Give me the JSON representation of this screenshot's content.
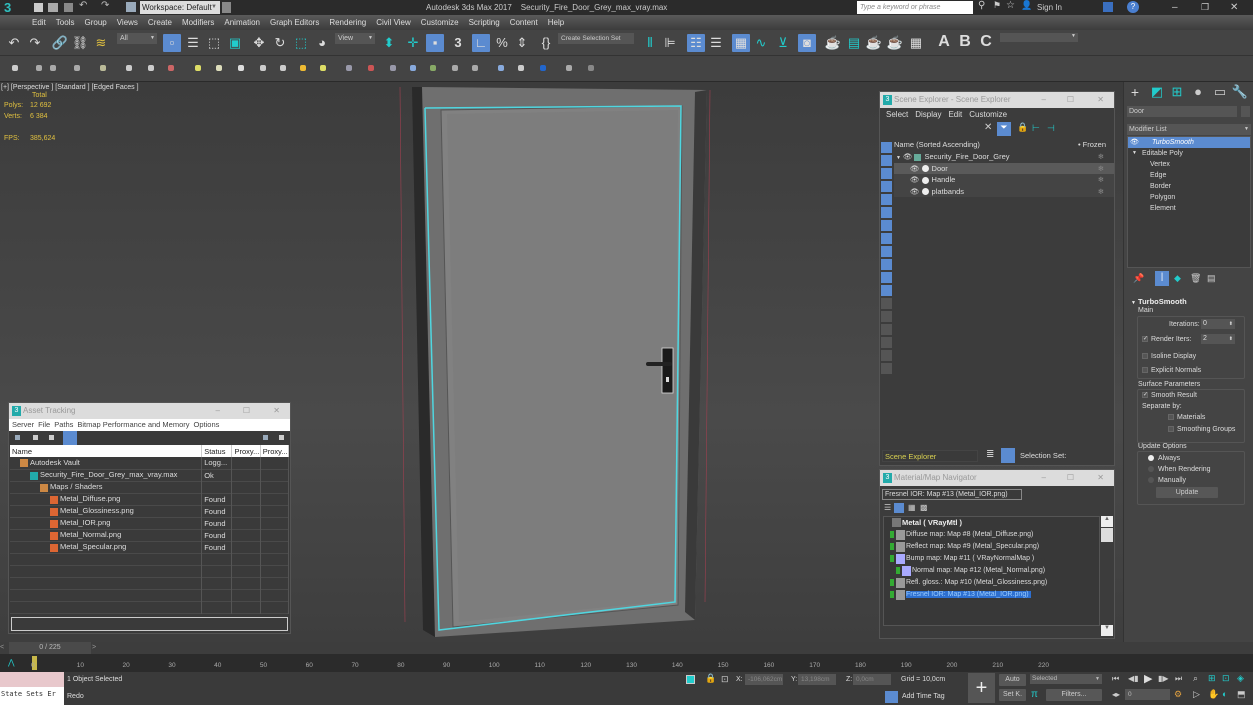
{
  "app": {
    "title": "Autodesk 3ds Max 2017",
    "file": "Security_Fire_Door_Grey_max_vray.max",
    "workspace": "Workspace: Default",
    "search_placeholder": "Type a keyword or phrase",
    "sign_in": "Sign In"
  },
  "menu": [
    "Edit",
    "Tools",
    "Group",
    "Views",
    "Create",
    "Modifiers",
    "Animation",
    "Graph Editors",
    "Rendering",
    "Civil View",
    "Customize",
    "Scripting",
    "Content",
    "Help"
  ],
  "toolbar": {
    "selection_filter": "All",
    "ref_coord": "View",
    "selection_set": "Create Selection Set",
    "icons": [
      "undo-icon",
      "redo-icon",
      "link-icon",
      "unlink-icon",
      "bind-space-warp-icon",
      "select-object-icon",
      "select-by-name-icon",
      "rect-selection-icon",
      "window-crossing-icon",
      "move-icon",
      "rotate-icon",
      "scale-icon",
      "place-icon",
      "mirror-icon",
      "align-icon",
      "snap-3d-icon",
      "angle-snap-icon",
      "percent-snap-icon",
      "spinner-snap-icon",
      "edit-named-sets-icon"
    ]
  },
  "viewport": {
    "label": "[+] [Perspective ] [Standard ] [Edged Faces ]",
    "total_label": "Total",
    "polys_label": "Polys:",
    "polys": "12 692",
    "verts_label": "Verts:",
    "verts": "6 384",
    "fps_label": "FPS:",
    "fps": "385,624"
  },
  "scene_explorer": {
    "title": "Scene Explorer - Scene Explorer",
    "menu": [
      "Select",
      "Display",
      "Edit",
      "Customize"
    ],
    "col_name": "Name (Sorted Ascending)",
    "col_frozen": "• Frozen",
    "items": [
      {
        "name": "Security_Fire_Door_Grey",
        "level": 0,
        "selected": false
      },
      {
        "name": "Door",
        "level": 1,
        "selected": true
      },
      {
        "name": "Handle",
        "level": 1,
        "selected": false
      },
      {
        "name": "platbands",
        "level": 1,
        "selected": false
      }
    ],
    "footer_name": "Scene Explorer",
    "selection_set_label": "Selection Set:"
  },
  "asset_tracking": {
    "title": "Asset Tracking",
    "menu": [
      "Server",
      "File",
      "Paths",
      "Bitmap Performance and Memory",
      "Options"
    ],
    "columns": [
      "Name",
      "Status",
      "Proxy...",
      "Proxy..."
    ],
    "rows": [
      {
        "name": "Autodesk Vault",
        "status": "Logg...",
        "level": 0,
        "icon": "vault"
      },
      {
        "name": "Security_Fire_Door_Grey_max_vray.max",
        "status": "Ok",
        "level": 1,
        "icon": "max"
      },
      {
        "name": "Maps / Shaders",
        "status": "",
        "level": 2,
        "icon": "folder"
      },
      {
        "name": "Metal_Diffuse.png",
        "status": "Found",
        "level": 3,
        "icon": "image"
      },
      {
        "name": "Metal_Glossiness.png",
        "status": "Found",
        "level": 3,
        "icon": "image"
      },
      {
        "name": "Metal_IOR.png",
        "status": "Found",
        "level": 3,
        "icon": "image"
      },
      {
        "name": "Metal_Normal.png",
        "status": "Found",
        "level": 3,
        "icon": "image"
      },
      {
        "name": "Metal_Specular.png",
        "status": "Found",
        "level": 3,
        "icon": "image"
      }
    ]
  },
  "material_navigator": {
    "title": "Material/Map Navigator",
    "current": "Fresnel IOR: Map #13 (Metal_IOR.png)",
    "root": "Metal  ( VRayMtl )",
    "items": [
      {
        "label": "Diffuse map: Map #8 (Metal_Diffuse.png)",
        "level": 1,
        "selected": false
      },
      {
        "label": "Reflect map: Map #9 (Metal_Specular.png)",
        "level": 1,
        "selected": false
      },
      {
        "label": "Bump map: Map #11  ( VRayNormalMap )",
        "level": 1,
        "selected": false
      },
      {
        "label": "Normal map: Map #12 (Metal_Normal.png)",
        "level": 2,
        "selected": false
      },
      {
        "label": "Refl. gloss.: Map #10 (Metal_Glossiness.png)",
        "level": 1,
        "selected": false
      },
      {
        "label": "Fresnel IOR: Map #13 (Metal_IOR.png)",
        "level": 1,
        "selected": true
      }
    ]
  },
  "command_panel": {
    "object_name": "Door",
    "modifier_list": "Modifier List",
    "stack": [
      {
        "label": "TurboSmooth",
        "type": "modifier",
        "selected": true
      },
      {
        "label": "Editable Poly",
        "type": "base",
        "selected": false
      },
      {
        "label": "Vertex",
        "type": "sub",
        "selected": false
      },
      {
        "label": "Edge",
        "type": "sub",
        "selected": false
      },
      {
        "label": "Border",
        "type": "sub",
        "selected": false
      },
      {
        "label": "Polygon",
        "type": "sub",
        "selected": false
      },
      {
        "label": "Element",
        "type": "sub",
        "selected": false
      }
    ],
    "rollout_title": "TurboSmooth",
    "main_label": "Main",
    "iterations_label": "Iterations:",
    "iterations": "0",
    "render_iters_label": "Render Iters:",
    "render_iters": "2",
    "render_iters_checked": true,
    "isoline_label": "Isoline Display",
    "isoline_checked": false,
    "explicit_normals_label": "Explicit Normals",
    "explicit_normals_checked": false,
    "surface_params_label": "Surface Parameters",
    "smooth_result_label": "Smooth Result",
    "smooth_result_checked": true,
    "separate_by_label": "Separate by:",
    "materials_label": "Materials",
    "smoothing_groups_label": "Smoothing Groups",
    "update_options_label": "Update Options",
    "update_options": [
      "Always",
      "When Rendering",
      "Manually"
    ],
    "update_selected": "Always",
    "update_button": "Update"
  },
  "timeline": {
    "frame_display": "0 / 225",
    "current_frame": 0,
    "total_frames": 225,
    "ticks": [
      0,
      10,
      20,
      30,
      40,
      50,
      60,
      70,
      80,
      90,
      100,
      110,
      120,
      130,
      140,
      150,
      160,
      170,
      180,
      190,
      200,
      210,
      220
    ]
  },
  "status": {
    "state_sets": "State Sets Er",
    "selection_info": "1 Object Selected",
    "prompt": "Redo",
    "x_label": "X:",
    "x_value": "-106,062cm",
    "y_label": "Y:",
    "y_value": "13,198cm",
    "z_label": "Z:",
    "z_value": "0,0cm",
    "grid": "Grid = 10,0cm",
    "add_time_tag": "Add Time Tag",
    "auto_key": "Auto",
    "set_key": "Set K.",
    "key_filter": "Selected",
    "filters": "Filters...",
    "frame_field": "0"
  },
  "colors": {
    "accent": "#5b8bd0",
    "selection_outline": "#4fd6e0",
    "stat_text": "#e0c040"
  }
}
